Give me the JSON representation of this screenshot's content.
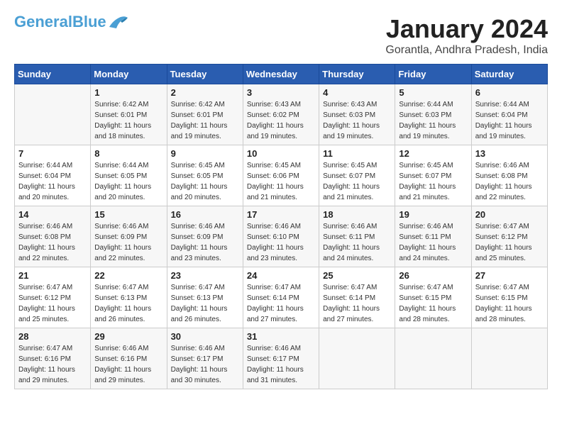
{
  "header": {
    "logo_general": "General",
    "logo_blue": "Blue",
    "month_title": "January 2024",
    "location": "Gorantla, Andhra Pradesh, India"
  },
  "calendar": {
    "days_of_week": [
      "Sunday",
      "Monday",
      "Tuesday",
      "Wednesday",
      "Thursday",
      "Friday",
      "Saturday"
    ],
    "weeks": [
      [
        {
          "day": "",
          "sunrise": "",
          "sunset": "",
          "daylight": ""
        },
        {
          "day": "1",
          "sunrise": "Sunrise: 6:42 AM",
          "sunset": "Sunset: 6:01 PM",
          "daylight": "Daylight: 11 hours and 18 minutes."
        },
        {
          "day": "2",
          "sunrise": "Sunrise: 6:42 AM",
          "sunset": "Sunset: 6:01 PM",
          "daylight": "Daylight: 11 hours and 19 minutes."
        },
        {
          "day": "3",
          "sunrise": "Sunrise: 6:43 AM",
          "sunset": "Sunset: 6:02 PM",
          "daylight": "Daylight: 11 hours and 19 minutes."
        },
        {
          "day": "4",
          "sunrise": "Sunrise: 6:43 AM",
          "sunset": "Sunset: 6:03 PM",
          "daylight": "Daylight: 11 hours and 19 minutes."
        },
        {
          "day": "5",
          "sunrise": "Sunrise: 6:44 AM",
          "sunset": "Sunset: 6:03 PM",
          "daylight": "Daylight: 11 hours and 19 minutes."
        },
        {
          "day": "6",
          "sunrise": "Sunrise: 6:44 AM",
          "sunset": "Sunset: 6:04 PM",
          "daylight": "Daylight: 11 hours and 19 minutes."
        }
      ],
      [
        {
          "day": "7",
          "sunrise": "Sunrise: 6:44 AM",
          "sunset": "Sunset: 6:04 PM",
          "daylight": "Daylight: 11 hours and 20 minutes."
        },
        {
          "day": "8",
          "sunrise": "Sunrise: 6:44 AM",
          "sunset": "Sunset: 6:05 PM",
          "daylight": "Daylight: 11 hours and 20 minutes."
        },
        {
          "day": "9",
          "sunrise": "Sunrise: 6:45 AM",
          "sunset": "Sunset: 6:05 PM",
          "daylight": "Daylight: 11 hours and 20 minutes."
        },
        {
          "day": "10",
          "sunrise": "Sunrise: 6:45 AM",
          "sunset": "Sunset: 6:06 PM",
          "daylight": "Daylight: 11 hours and 21 minutes."
        },
        {
          "day": "11",
          "sunrise": "Sunrise: 6:45 AM",
          "sunset": "Sunset: 6:07 PM",
          "daylight": "Daylight: 11 hours and 21 minutes."
        },
        {
          "day": "12",
          "sunrise": "Sunrise: 6:45 AM",
          "sunset": "Sunset: 6:07 PM",
          "daylight": "Daylight: 11 hours and 21 minutes."
        },
        {
          "day": "13",
          "sunrise": "Sunrise: 6:46 AM",
          "sunset": "Sunset: 6:08 PM",
          "daylight": "Daylight: 11 hours and 22 minutes."
        }
      ],
      [
        {
          "day": "14",
          "sunrise": "Sunrise: 6:46 AM",
          "sunset": "Sunset: 6:08 PM",
          "daylight": "Daylight: 11 hours and 22 minutes."
        },
        {
          "day": "15",
          "sunrise": "Sunrise: 6:46 AM",
          "sunset": "Sunset: 6:09 PM",
          "daylight": "Daylight: 11 hours and 22 minutes."
        },
        {
          "day": "16",
          "sunrise": "Sunrise: 6:46 AM",
          "sunset": "Sunset: 6:09 PM",
          "daylight": "Daylight: 11 hours and 23 minutes."
        },
        {
          "day": "17",
          "sunrise": "Sunrise: 6:46 AM",
          "sunset": "Sunset: 6:10 PM",
          "daylight": "Daylight: 11 hours and 23 minutes."
        },
        {
          "day": "18",
          "sunrise": "Sunrise: 6:46 AM",
          "sunset": "Sunset: 6:11 PM",
          "daylight": "Daylight: 11 hours and 24 minutes."
        },
        {
          "day": "19",
          "sunrise": "Sunrise: 6:46 AM",
          "sunset": "Sunset: 6:11 PM",
          "daylight": "Daylight: 11 hours and 24 minutes."
        },
        {
          "day": "20",
          "sunrise": "Sunrise: 6:47 AM",
          "sunset": "Sunset: 6:12 PM",
          "daylight": "Daylight: 11 hours and 25 minutes."
        }
      ],
      [
        {
          "day": "21",
          "sunrise": "Sunrise: 6:47 AM",
          "sunset": "Sunset: 6:12 PM",
          "daylight": "Daylight: 11 hours and 25 minutes."
        },
        {
          "day": "22",
          "sunrise": "Sunrise: 6:47 AM",
          "sunset": "Sunset: 6:13 PM",
          "daylight": "Daylight: 11 hours and 26 minutes."
        },
        {
          "day": "23",
          "sunrise": "Sunrise: 6:47 AM",
          "sunset": "Sunset: 6:13 PM",
          "daylight": "Daylight: 11 hours and 26 minutes."
        },
        {
          "day": "24",
          "sunrise": "Sunrise: 6:47 AM",
          "sunset": "Sunset: 6:14 PM",
          "daylight": "Daylight: 11 hours and 27 minutes."
        },
        {
          "day": "25",
          "sunrise": "Sunrise: 6:47 AM",
          "sunset": "Sunset: 6:14 PM",
          "daylight": "Daylight: 11 hours and 27 minutes."
        },
        {
          "day": "26",
          "sunrise": "Sunrise: 6:47 AM",
          "sunset": "Sunset: 6:15 PM",
          "daylight": "Daylight: 11 hours and 28 minutes."
        },
        {
          "day": "27",
          "sunrise": "Sunrise: 6:47 AM",
          "sunset": "Sunset: 6:15 PM",
          "daylight": "Daylight: 11 hours and 28 minutes."
        }
      ],
      [
        {
          "day": "28",
          "sunrise": "Sunrise: 6:47 AM",
          "sunset": "Sunset: 6:16 PM",
          "daylight": "Daylight: 11 hours and 29 minutes."
        },
        {
          "day": "29",
          "sunrise": "Sunrise: 6:46 AM",
          "sunset": "Sunset: 6:16 PM",
          "daylight": "Daylight: 11 hours and 29 minutes."
        },
        {
          "day": "30",
          "sunrise": "Sunrise: 6:46 AM",
          "sunset": "Sunset: 6:17 PM",
          "daylight": "Daylight: 11 hours and 30 minutes."
        },
        {
          "day": "31",
          "sunrise": "Sunrise: 6:46 AM",
          "sunset": "Sunset: 6:17 PM",
          "daylight": "Daylight: 11 hours and 31 minutes."
        },
        {
          "day": "",
          "sunrise": "",
          "sunset": "",
          "daylight": ""
        },
        {
          "day": "",
          "sunrise": "",
          "sunset": "",
          "daylight": ""
        },
        {
          "day": "",
          "sunrise": "",
          "sunset": "",
          "daylight": ""
        }
      ]
    ]
  }
}
